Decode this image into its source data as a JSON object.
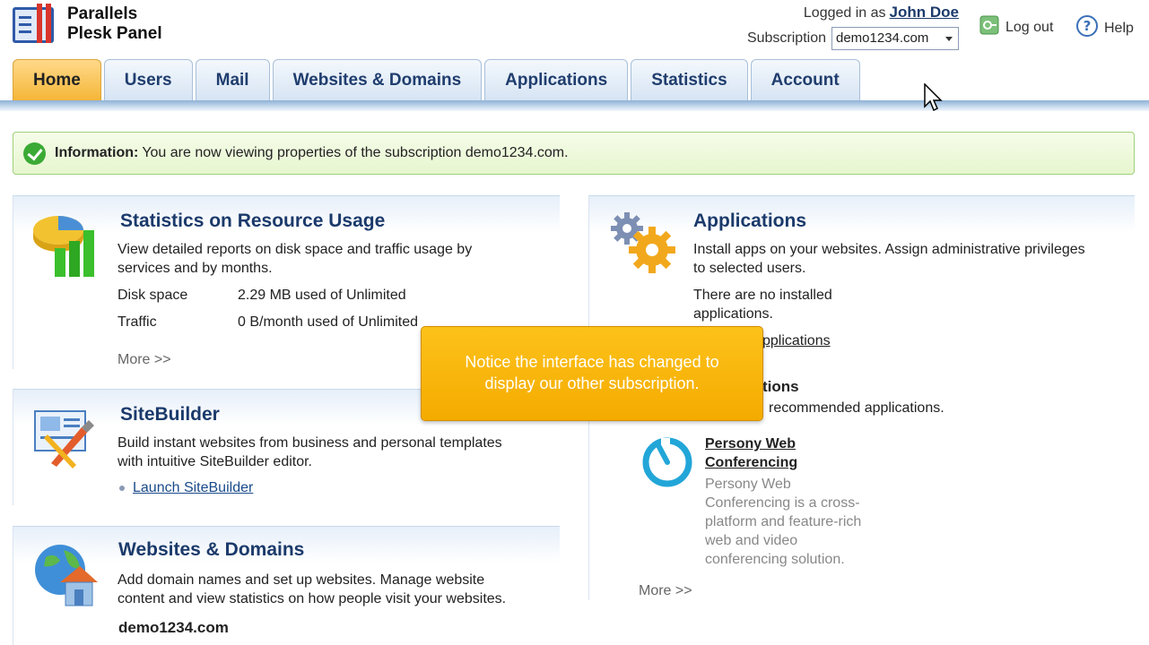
{
  "app": {
    "name_line1": "Parallels",
    "name_line2": "Plesk Panel"
  },
  "header": {
    "logged_in_label": "Logged in as",
    "user_name": "John Doe",
    "subscription_label": "Subscription",
    "subscription_value": "demo1234.com",
    "logout_label": "Log out",
    "help_label": "Help"
  },
  "tabs": [
    {
      "label": "Home",
      "active": true
    },
    {
      "label": "Users"
    },
    {
      "label": "Mail"
    },
    {
      "label": "Websites & Domains"
    },
    {
      "label": "Applications"
    },
    {
      "label": "Statistics"
    },
    {
      "label": "Account"
    }
  ],
  "info": {
    "label": "Information:",
    "text": "You are now viewing properties of the subscription demo1234.com."
  },
  "stats": {
    "title": "Statistics on Resource Usage",
    "desc_1": "View detailed reports on disk space and traffic usage by",
    "desc_2": "services and by months.",
    "disk_label": "Disk space",
    "disk_value": "2.29 MB used of Unlimited",
    "traffic_label": "Traffic",
    "traffic_value": "0 B/month used of Unlimited",
    "more": "More >>"
  },
  "sitebuilder": {
    "title": "SiteBuilder",
    "desc_1": "Build instant websites from business and personal templates",
    "desc_2": "with intuitive SiteBuilder editor.",
    "link": "Launch SiteBuilder"
  },
  "websites": {
    "title": "Websites & Domains",
    "desc_1": "Add domain names and set up websites. Manage website",
    "desc_2": "content and view statistics on how people visit your websites.",
    "domain": "demo1234.com"
  },
  "applications": {
    "title": "Applications",
    "desc_1": "Install apps on your websites. Assign administrative privileges",
    "desc_2": "to selected users.",
    "none_1": "There are no installed",
    "none_2": "applications.",
    "link_partial": "pplications",
    "sub_partial": "tions",
    "recommended_partial": "recommended applications.",
    "app_name_1": "Persony Web",
    "app_name_2": "Conferencing",
    "app_desc_1": "Persony Web",
    "app_desc_2": "Conferencing is a cross-",
    "app_desc_3": "platform and feature-rich",
    "app_desc_4": "web and video",
    "app_desc_5": "conferencing solution.",
    "more": "More >>"
  },
  "callout": {
    "line1": "Notice the interface has changed to",
    "line2": "display our other subscription."
  },
  "colors": {
    "accent": "#1b3a6b",
    "active_tab": "#f5b637",
    "callout": "#f5ab00",
    "success": "#3aaa35"
  }
}
